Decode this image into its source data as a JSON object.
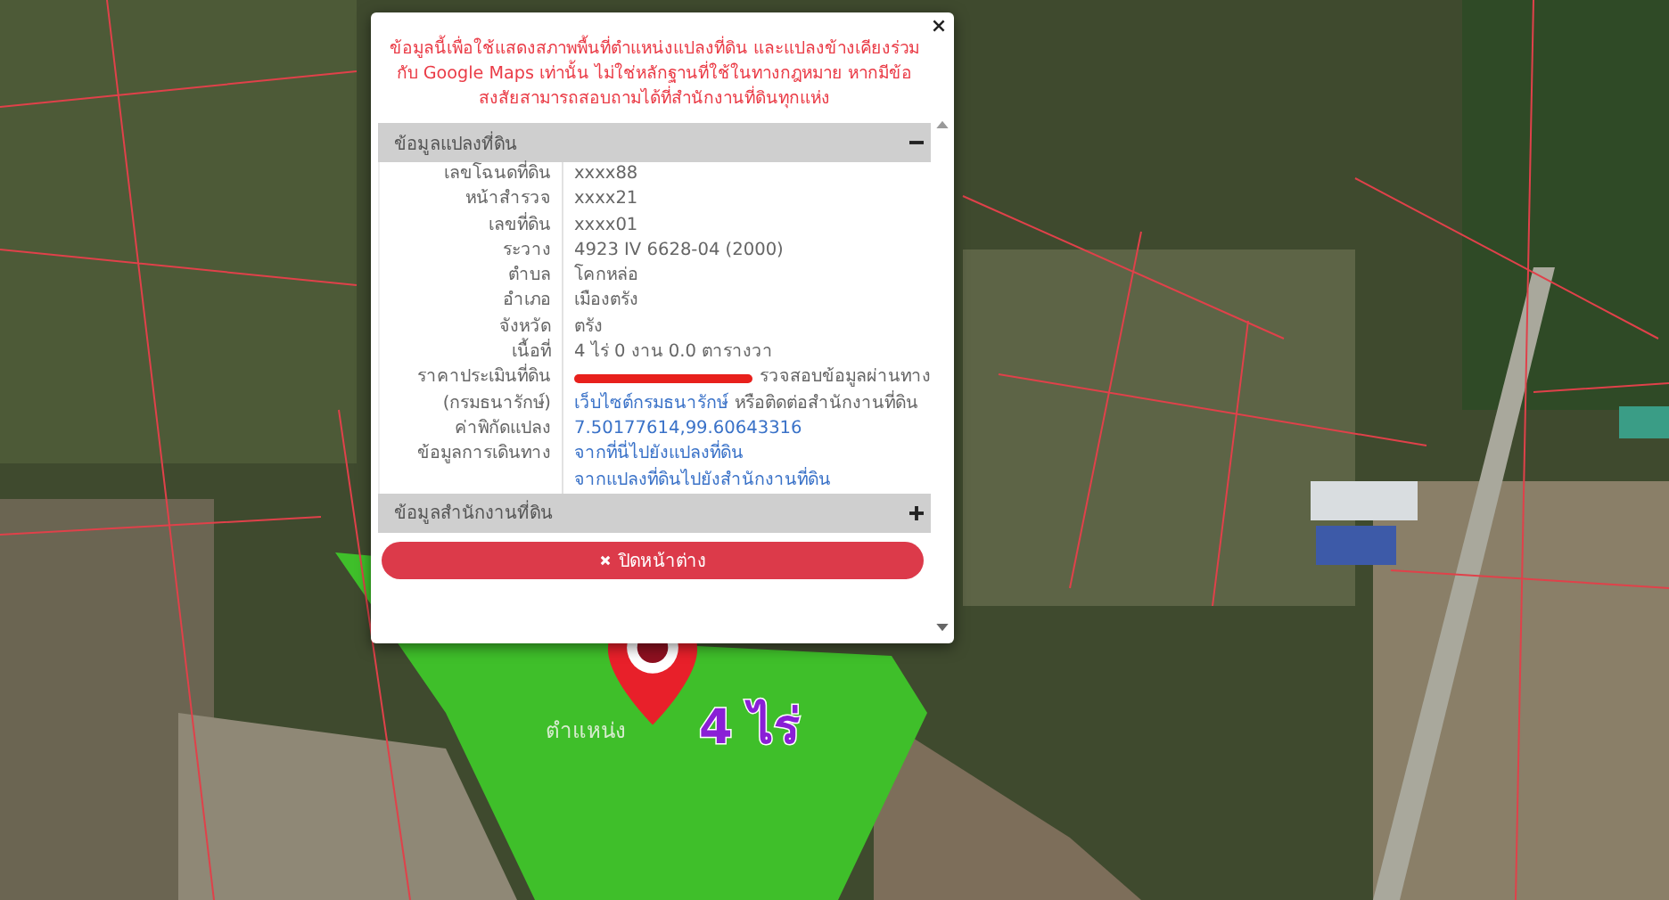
{
  "notice": "ข้อมูลนี้เพื่อใช้แสดงสภาพพื้นที่ตำแหน่งแปลงที่ดิน และแปลงข้างเคียงร่วมกับ Google Maps เท่านั้น ไม่ใช่หลักฐานที่ใช้ในทางกฎหมาย หากมีข้อสงสัยสามารถสอบถามได้ที่สำนักงานที่ดินทุกแห่ง",
  "sections": [
    {
      "title": "ข้อมูลแปลงที่ดิน",
      "expanded": true,
      "rows": [
        {
          "label": "เลขโฉนดที่ดิน",
          "lines": [
            [
              {
                "kind": "text",
                "text": "xxxx88"
              }
            ]
          ]
        },
        {
          "label": "หน้าสำรวจ",
          "lines": [
            [
              {
                "kind": "text",
                "text": "xxxx21"
              }
            ]
          ]
        },
        {
          "label": "เลขที่ดิน",
          "lines": [
            [
              {
                "kind": "text",
                "text": "xxxx01"
              }
            ]
          ]
        },
        {
          "label": "ระวาง",
          "lines": [
            [
              {
                "kind": "text",
                "text": "4923 IV 6628-04 (2000)"
              }
            ]
          ]
        },
        {
          "label": "ตำบล",
          "lines": [
            [
              {
                "kind": "text",
                "text": "โคกหล่อ"
              }
            ]
          ]
        },
        {
          "label": "อำเภอ",
          "lines": [
            [
              {
                "kind": "text",
                "text": "เมืองตรัง"
              }
            ]
          ]
        },
        {
          "label": "จังหวัด",
          "lines": [
            [
              {
                "kind": "text",
                "text": "ตรัง"
              }
            ]
          ]
        },
        {
          "label": "เนื้อที่",
          "lines": [
            [
              {
                "kind": "text",
                "text": "4 ไร่ 0 งาน 0.0 ตารางวา"
              }
            ]
          ]
        },
        {
          "label": "ราคาประเมินที่ดิน",
          "lines": [
            [
              {
                "kind": "redacted",
                "text": "รวจสอบข้อมูลผ่านทาง"
              }
            ]
          ]
        },
        {
          "label": "(กรมธนารักษ์)",
          "lines": [
            [
              {
                "kind": "link",
                "text": "เว็บไซต์กรมธนารักษ์"
              },
              {
                "kind": "text",
                "text": "หรือติดต่อสำนักงานที่ดิน"
              }
            ]
          ]
        },
        {
          "label": "ค่าพิกัดแปลง",
          "lines": [
            [
              {
                "kind": "link",
                "text": "7.50177614,99.60643316"
              }
            ]
          ]
        },
        {
          "label": "ข้อมูลการเดินทาง",
          "lines": [
            [
              {
                "kind": "link",
                "text": "จากที่นี่ไปยังแปลงที่ดิน"
              }
            ],
            [
              {
                "kind": "link",
                "text": "จากแปลงที่ดินไปยังสำนักงานที่ดิน"
              }
            ]
          ]
        }
      ]
    },
    {
      "title": "ข้อมูลสำนักงานที่ดิน",
      "expanded": false
    }
  ],
  "close_button": "ปิดหน้าต่าง",
  "map": {
    "parcel_label": "ตำแหน่ง",
    "area_label": "4 ไร่"
  }
}
